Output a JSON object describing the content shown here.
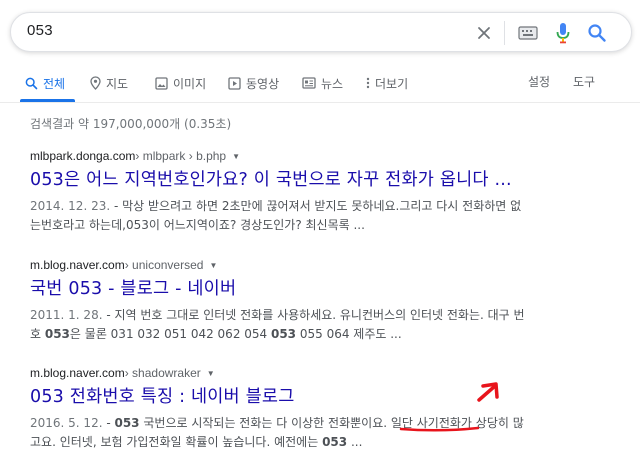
{
  "search": {
    "query": "053"
  },
  "tabs": [
    {
      "label": "전체",
      "icon": "search-icon",
      "active": true
    },
    {
      "label": "지도",
      "icon": "map-pin-icon"
    },
    {
      "label": "이미지",
      "icon": "image-icon"
    },
    {
      "label": "동영상",
      "icon": "video-icon"
    },
    {
      "label": "뉴스",
      "icon": "news-icon"
    },
    {
      "label": "더보기",
      "icon": "more-vert-icon"
    }
  ],
  "tools": {
    "settings": "설정",
    "tools": "도구"
  },
  "stats": "검색결과 약 197,000,000개 (0.35초)",
  "results": [
    {
      "domain": "mlbpark.donga.com",
      "crumb": " › mlbpark › b.php",
      "title": "053은 어느 지역번호인가요? 이 국번으로 자꾸 전화가 옵니다 ...",
      "date": "2014. 12. 23.",
      "line1": " - 막상 받으려고 하면 2초만에 끊어져서 받지도 못하네요.그리고 다시 전화하면 없",
      "line2": "는번호라고 하는데,053이 어느지역이죠? 경상도인가? 최신목록 ..."
    },
    {
      "domain": "m.blog.naver.com",
      "crumb": " › uniconversed",
      "title": "국번 053 - 블로그 - 네이버",
      "date": "2011. 1. 28.",
      "line1": " - 지역 번호 그대로 인터넷 전화를 사용하세요. 유니컨버스의 인터넷 전화는. 대구 번",
      "line2_pre": "호 ",
      "line2_b1": "053",
      "line2_mid": "은 물론 031 032 051 042 062 054 ",
      "line2_b2": "053",
      "line2_post": " 055 064 제주도 ..."
    },
    {
      "domain": "m.blog.naver.com",
      "crumb": " › shadowraker",
      "title": "053 전화번호 특징 : 네이버 블로그",
      "date": "2016. 5. 12.",
      "line1_pre": " - ",
      "line1_b": "053",
      "line1_post": " 국번으로 시작되는 전화는 다 이상한 전화뿐이요. 일단 사기전화가 상당히 많",
      "line2_pre": "고요. 인터넷, 보험 가입전화일 확률이 높습니다. 예전에는 ",
      "line2_b": "053",
      "line2_post": " ..."
    }
  ],
  "colors": {
    "link": "#1a0dab",
    "accent": "#1a73e8",
    "annotation": "#e8141c"
  }
}
